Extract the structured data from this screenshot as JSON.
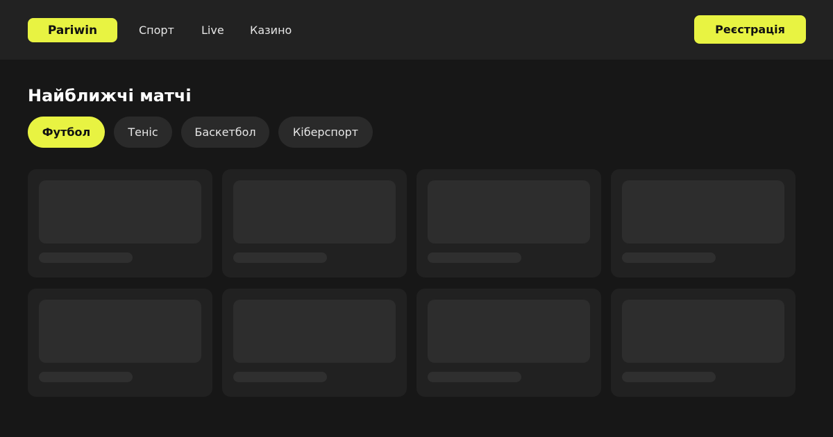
{
  "header": {
    "logo": "Pariwin",
    "nav": [
      "Спорт",
      "Live",
      "Казино"
    ],
    "register_label": "Реєстрація",
    "accent_color": "#e8f342"
  },
  "main": {
    "title": "Найближчі матчі",
    "tabs": [
      {
        "label": "Футбол",
        "active": true
      },
      {
        "label": "Теніс",
        "active": false
      },
      {
        "label": "Баскетбол",
        "active": false
      },
      {
        "label": "Кіберспорт",
        "active": false
      }
    ],
    "match_cards_state": "loading-placeholders",
    "match_cards_count": 8
  }
}
